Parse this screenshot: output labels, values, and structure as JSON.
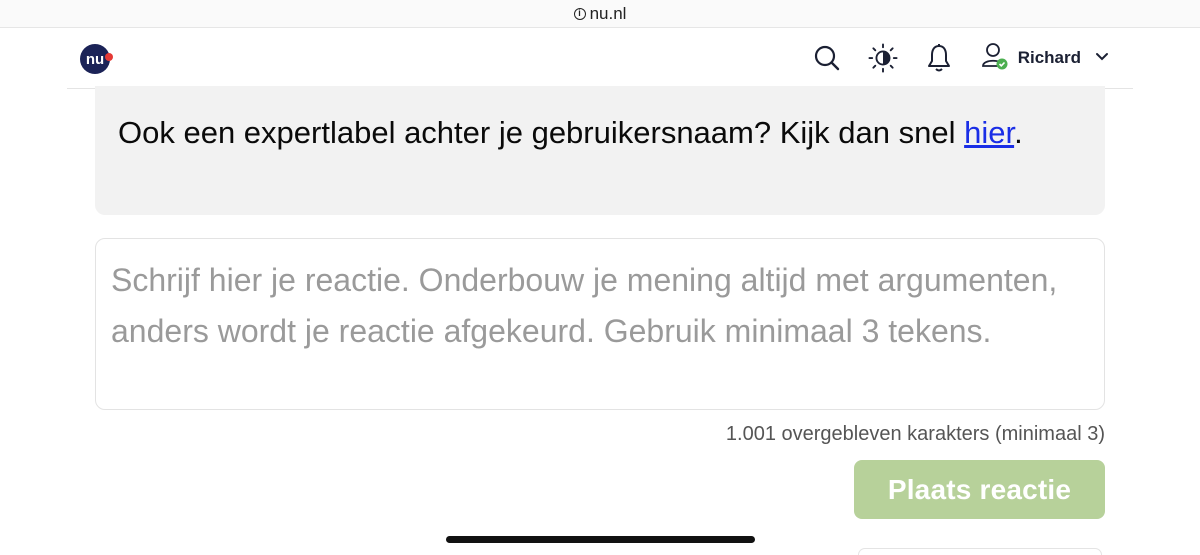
{
  "browser": {
    "url": "nu.nl"
  },
  "header": {
    "user_name": "Richard",
    "icons": [
      "nu-logo-icon",
      "search-icon",
      "theme-toggle-icon",
      "bell-icon",
      "user-verified-icon",
      "chevron-down-icon"
    ],
    "colors": {
      "logo": "#1b2357",
      "logo_badge": "#e53935",
      "verified_badge": "#4caf50"
    }
  },
  "banner": {
    "text": "Ook een expertlabel achter je gebruikersnaam? Kijk dan snel",
    "link_label": "hier",
    "suffix": "."
  },
  "comment": {
    "placeholder": "Schrijf hier je reactie. Onderbouw je mening altijd met argumenten, anders wordt je reactie afgekeurd. Gebruik minimaal 3 tekens.",
    "value": ""
  },
  "counter": {
    "text": "1.001 overgebleven karakters (minimaal 3)"
  },
  "submit": {
    "label": "Plaats reactie",
    "color": "#b7d19a"
  }
}
